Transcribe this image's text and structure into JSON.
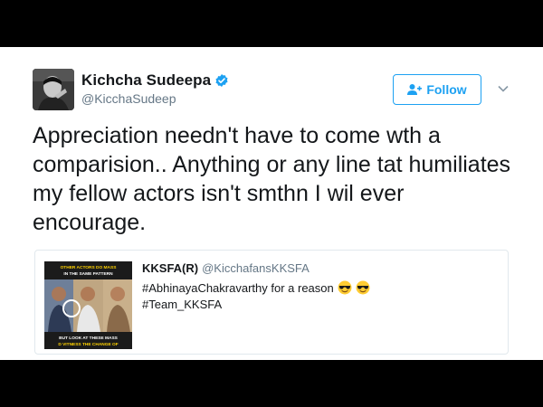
{
  "tweet": {
    "display_name": "Kichcha Sudeepa",
    "handle": "@KicchaSudeep",
    "verified_icon": "verified-badge-icon",
    "follow_label": "Follow",
    "text": "Appreciation needn't have to come wth a comparision.. Anything or any line tat humiliates my fellow actors isn't smthn I wil ever encourage."
  },
  "quoted": {
    "display_name": "KKSFA(R)",
    "handle": "@KicchafansKKSFA",
    "line1": "#AbhinayaChakravarthy for a reason",
    "emoji": "smiling-face-with-sunglasses",
    "line2": "#Team_KKSFA",
    "image_caption_top_1": "OTHER ACTORS DO MASS",
    "image_caption_top_2": "IN THE SAME PATTERN",
    "image_caption_bottom_1": "BUT LOOK AT THESE MASS",
    "image_caption_bottom_2": "D VITNESS THE CHANGE OF"
  },
  "colors": {
    "accent": "#1da1f2",
    "text": "#14171a",
    "secondary": "#657786",
    "border": "#e1e8ed"
  }
}
